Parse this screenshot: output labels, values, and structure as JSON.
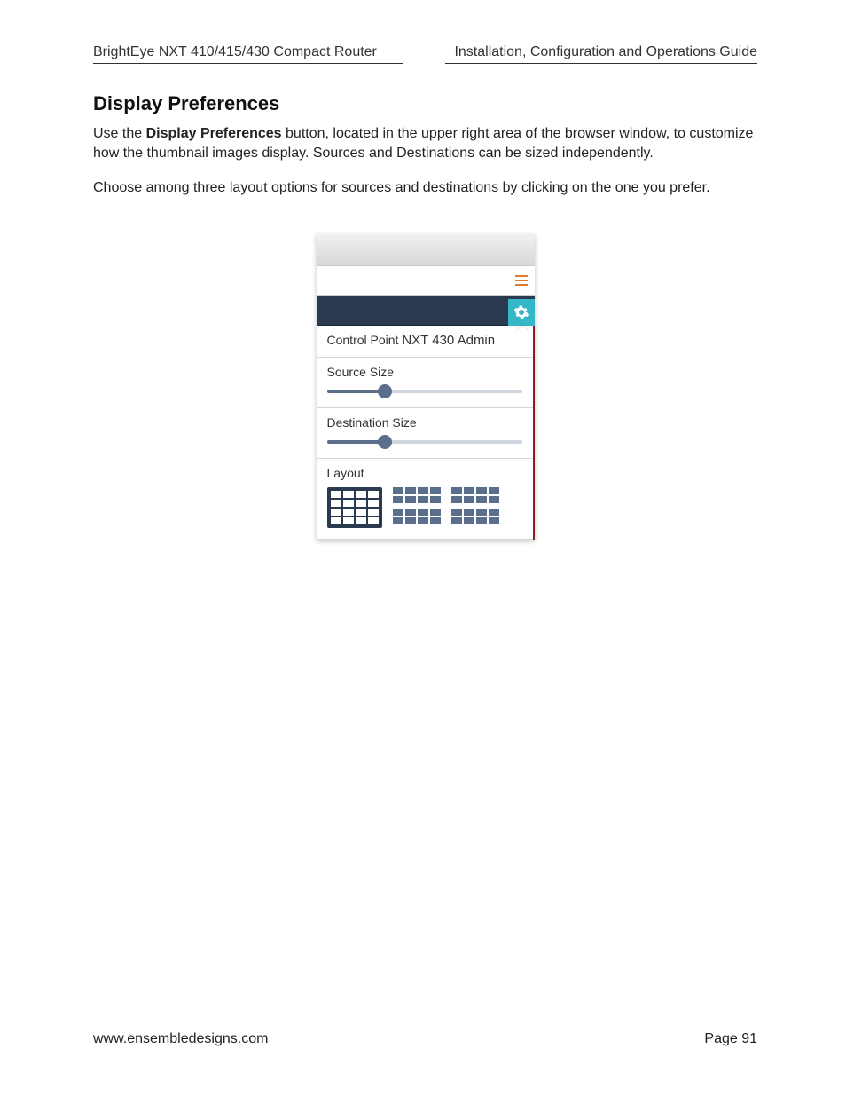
{
  "header": {
    "left": "BrightEye NXT 410/415/430 Compact Router",
    "right": "Installation, Configuration and Operations Guide"
  },
  "section": {
    "title": "Display Preferences",
    "p1_a": "Use the ",
    "p1_bold": "Display Preferences",
    "p1_b": " button, located in the upper right area of the browser window, to customize how the thumbnail images display. Sources and Destinations can be sized independently.",
    "p2": "Choose among three layout options for sources and destinations by clicking on the one you prefer."
  },
  "panel": {
    "control_point_label": "Control Point ",
    "control_point_name": "NXT 430 Admin",
    "source_size_label": "Source Size",
    "destination_size_label": "Destination Size",
    "layout_label": "Layout"
  },
  "footer": {
    "url": "www.ensembledesigns.com",
    "page": "Page 91"
  }
}
